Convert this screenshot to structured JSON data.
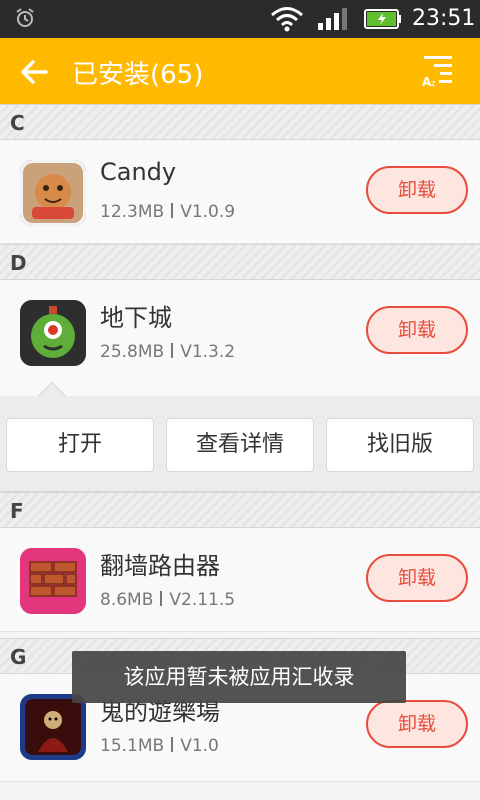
{
  "status_bar": {
    "time": "23:51"
  },
  "app_bar": {
    "title": "已安装(65)"
  },
  "sections": [
    {
      "letter": "C"
    },
    {
      "letter": "D"
    },
    {
      "letter": "F"
    },
    {
      "letter": "G"
    }
  ],
  "apps": [
    {
      "name": "Candy",
      "size": "12.3MB",
      "version": "V1.0.9",
      "action": "卸载"
    },
    {
      "name": "地下城",
      "size": "25.8MB",
      "version": "V1.3.2",
      "action": "卸载"
    },
    {
      "name": "翻墙路由器",
      "size": "8.6MB",
      "version": "V2.11.5",
      "action": "卸载"
    },
    {
      "name": "鬼的遊樂場",
      "size": "15.1MB",
      "version": "V1.0",
      "action": "卸载"
    }
  ],
  "actions": {
    "open": "打开",
    "details": "查看详情",
    "old_version": "找旧版"
  },
  "toast": "该应用暂未被应用汇收录",
  "colors": {
    "accent": "#ffb900",
    "uninstall": "#e84d3c",
    "statusbar": "#2b2b2b"
  }
}
